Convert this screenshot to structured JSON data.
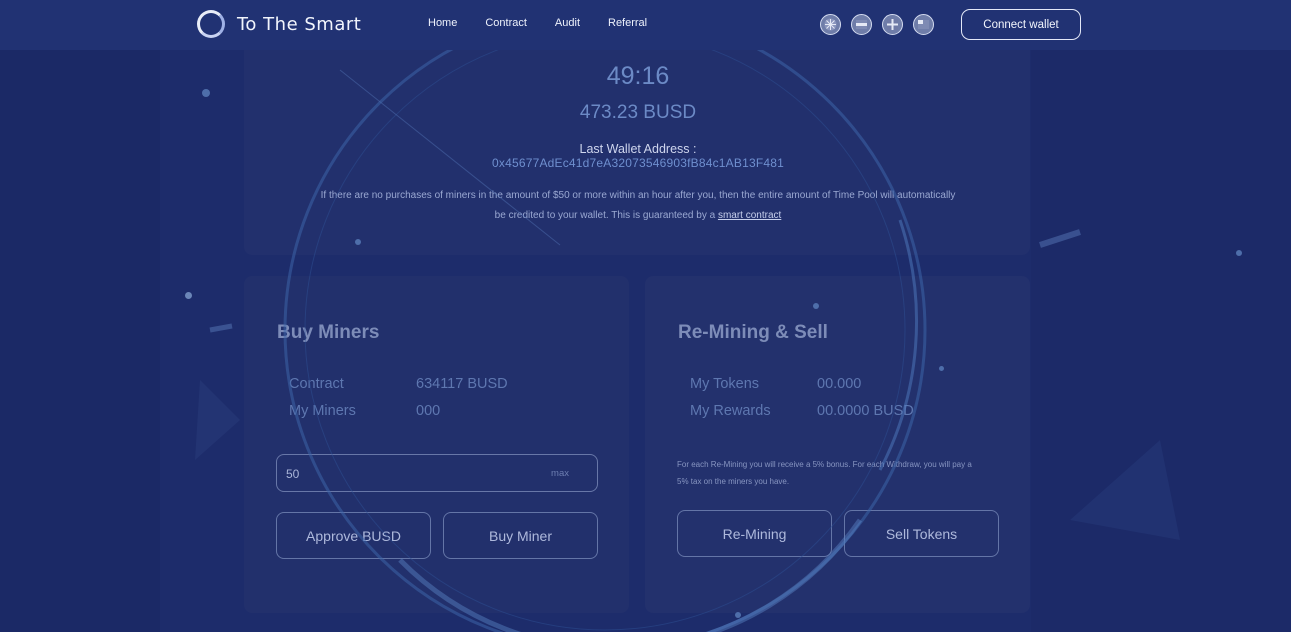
{
  "header": {
    "brand": "To The Smart",
    "nav": [
      "Home",
      "Contract",
      "Audit",
      "Referral"
    ],
    "languages": [
      "flag-1-icon",
      "flag-2-icon",
      "flag-3-icon",
      "flag-4-icon"
    ],
    "connect_label": "Connect wallet"
  },
  "pool": {
    "timer": "49:16",
    "amount": "473.23 BUSD",
    "last_wallet_label": "Last Wallet Address :",
    "last_wallet_address": "0x45677AdEc41d7eA32073546903fB84c1AB13F481",
    "notice_text": "If there are no purchases of miners in the amount of $50 or more within an hour after you, then the entire amount of Time Pool will automatically be credited to your wallet. This is guaranteed by a ",
    "notice_link": "smart contract"
  },
  "buy": {
    "title": "Buy Miners",
    "contract_label": "Contract",
    "contract_value": "634117 BUSD",
    "miners_label": "My Miners",
    "miners_value": "000",
    "input_value": "50",
    "max_label": "max",
    "approve_label": "Approve BUSD",
    "buy_label": "Buy Miner"
  },
  "sell": {
    "title": "Re-Mining & Sell",
    "tokens_label": "My Tokens",
    "tokens_value": "00.000",
    "rewards_label": "My Rewards",
    "rewards_value": "00.0000 BUSD",
    "notice": "For each Re-Mining you will receive a 5% bonus. For each Withdraw, you will pay a 5% tax on the miners you have.",
    "remining_label": "Re-Mining",
    "sell_label": "Sell Tokens"
  },
  "colors": {
    "background": "#1d2c6b",
    "header": "#213273",
    "accent_text": "#6c8ac6",
    "address": "#6f8fcf"
  }
}
